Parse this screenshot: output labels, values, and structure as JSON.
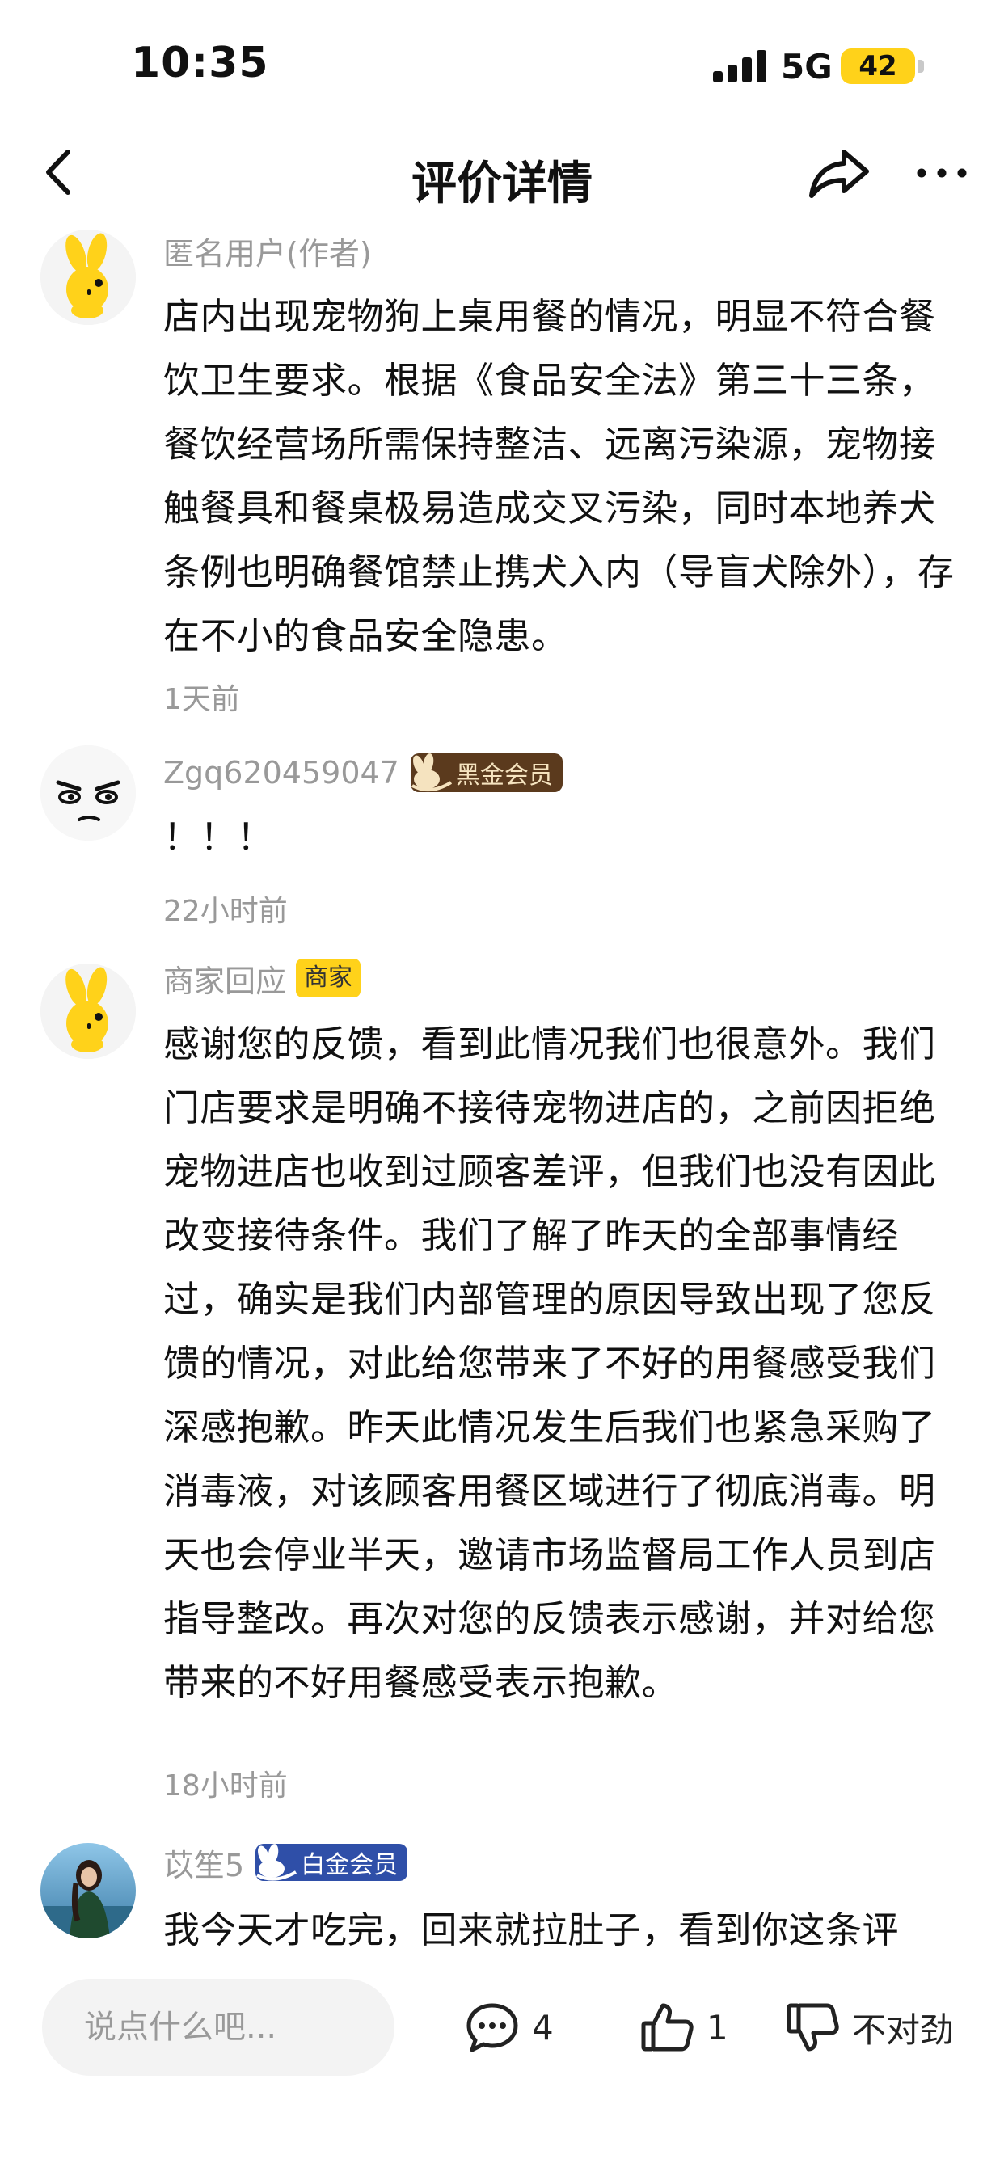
{
  "status_bar": {
    "time": "10:35",
    "network": "5G",
    "battery": "42"
  },
  "nav": {
    "title": "评价详情",
    "back_icon": "chevron-left-icon",
    "share_icon": "share-icon",
    "more_icon": "more-icon"
  },
  "comments": [
    {
      "name": "匿名用户(作者)",
      "body": "店内出现宠物狗上桌用餐的情况，明显不符合餐饮卫生要求。根据《食品安全法》第三十三条，餐饮经营场所需保持整洁、远离污染源，宠物接触餐具和餐桌极易造成交叉污染，同时本地养犬条例也明确餐馆禁止携犬入内（导盲犬除外），存在不小的食品安全隐患。",
      "time": "1天前"
    },
    {
      "name": "Zgq620459047",
      "badge": "黑金会员",
      "body": "！！！",
      "time": "22小时前"
    },
    {
      "name": "商家回应",
      "badge": "商家",
      "body": "感谢您的反馈，看到此情况我们也很意外。我们门店要求是明确不接待宠物进店的，之前因拒绝宠物进店也收到过顾客差评，但我们也没有因此改变接待条件。我们了解了昨天的全部事情经过，确实是我们内部管理的原因导致出现了您反馈的情况，对此给您带来了不好的用餐感受我们深感抱歉。昨天此情况发生后我们也紧急采购了消毒液，对该顾客用餐区域进行了彻底消毒。明天也会停业半天，邀请市场监督局工作人员到店指导整改。再次对您的反馈表示感谢，并对给您带来的不好用餐感受表示抱歉。",
      "time": "18小时前"
    },
    {
      "name": "苡笙5",
      "badge": "白金会员",
      "body": "我今天才吃完，回来就拉肚子，看到你这条评"
    }
  ],
  "bottom_bar": {
    "input_placeholder": "说点什么吧...",
    "comment_count": "4",
    "like_count": "1",
    "dislike_label": "不对劲"
  },
  "colors": {
    "accent_yellow": "#ffd21a",
    "muted_text": "#999999",
    "black_gold_badge": "#5b3a1d",
    "platinum_badge": "#2f4fa8"
  }
}
